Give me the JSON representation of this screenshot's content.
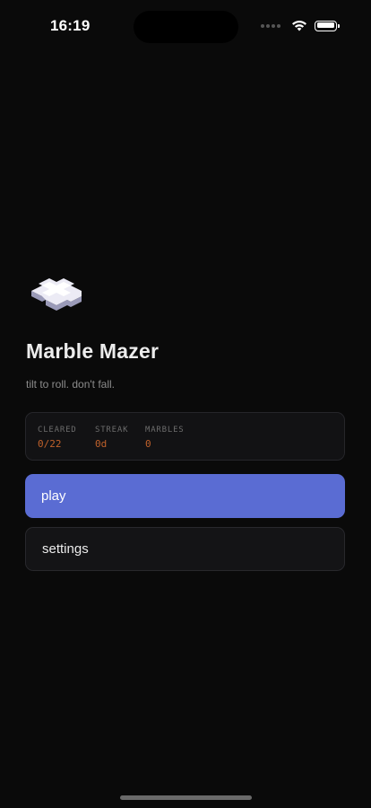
{
  "status_bar": {
    "time": "16:19"
  },
  "app": {
    "title": "Marble Mazer",
    "tagline": "tilt to roll. don't fall."
  },
  "stats": [
    {
      "label": "CLEARED",
      "value": "0/22"
    },
    {
      "label": "STREAK",
      "value": "0d"
    },
    {
      "label": "MARBLES",
      "value": "0"
    }
  ],
  "buttons": {
    "play": "play",
    "settings": "settings"
  },
  "colors": {
    "background": "#0a0a0a",
    "accent": "#5a6cd3",
    "stat_value": "#c0612b"
  },
  "icons": {
    "logo": "cross-block-logo-icon",
    "wifi": "wifi-icon",
    "battery": "battery-icon"
  }
}
